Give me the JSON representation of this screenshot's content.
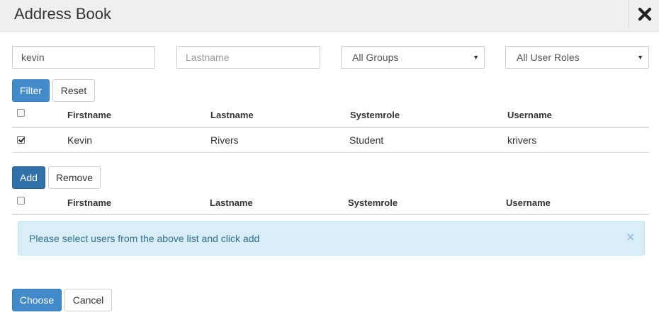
{
  "dialog": {
    "title": "Address Book",
    "close_icon": "close-icon"
  },
  "filters": {
    "firstname_value": "kevin",
    "firstname_placeholder": "",
    "lastname_value": "",
    "lastname_placeholder": "Lastname",
    "group_select": "All Groups",
    "role_select": "All User Roles",
    "filter_label": "Filter",
    "reset_label": "Reset"
  },
  "results_table": {
    "headers": [
      "Firstname",
      "Lastname",
      "Systemrole",
      "Username"
    ],
    "rows": [
      {
        "checked": true,
        "cells": [
          "Kevin",
          "Rivers",
          "Student",
          "krivers"
        ]
      }
    ]
  },
  "actions": {
    "add_label": "Add",
    "remove_label": "Remove"
  },
  "selected_table": {
    "headers": [
      "Firstname",
      "Lastname",
      "Systemrole",
      "Username"
    ],
    "rows": []
  },
  "alert": {
    "message": "Please select users from the above list and click add",
    "close_glyph": "×"
  },
  "footer": {
    "choose_label": "Choose",
    "cancel_label": "Cancel"
  },
  "colors": {
    "primary": "#428bca",
    "alert_bg": "#d9edf7",
    "alert_text": "#31708f"
  }
}
